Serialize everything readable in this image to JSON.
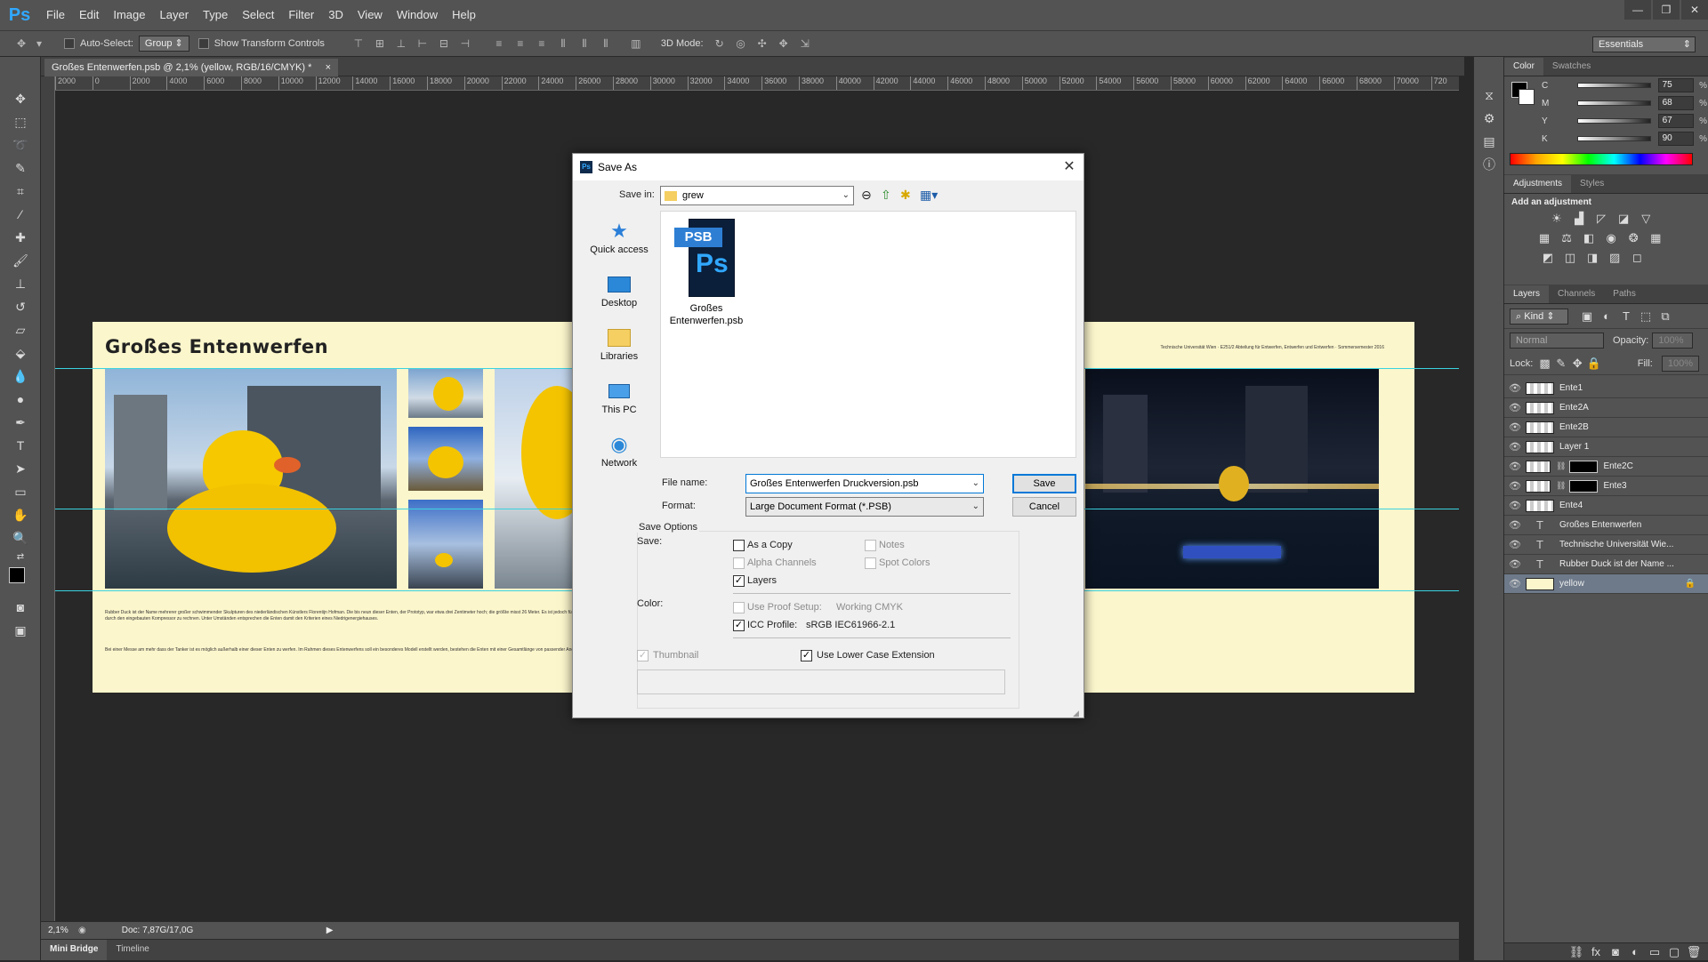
{
  "app": {
    "logo": "Ps",
    "menu": [
      "File",
      "Edit",
      "Image",
      "Layer",
      "Type",
      "Select",
      "Filter",
      "3D",
      "View",
      "Window",
      "Help"
    ]
  },
  "options_bar": {
    "auto_select_label": "Auto-Select:",
    "auto_select_value": "Group",
    "show_transform_label": "Show Transform Controls",
    "mode_3d_label": "3D Mode:",
    "workspace": "Essentials"
  },
  "document": {
    "tab_title": "Großes Entenwerfen.psb @ 2,1% (yellow, RGB/16/CMYK) *",
    "ruler_ticks": [
      "2000",
      "0",
      "2000",
      "4000",
      "6000",
      "8000",
      "10000",
      "12000",
      "14000",
      "16000",
      "18000",
      "20000",
      "22000",
      "24000",
      "26000",
      "28000",
      "30000",
      "32000",
      "34000",
      "36000",
      "38000",
      "40000",
      "42000",
      "44000",
      "46000",
      "48000",
      "50000",
      "52000",
      "54000",
      "56000",
      "58000",
      "60000",
      "62000",
      "64000",
      "66000",
      "68000",
      "70000",
      "720"
    ],
    "artboard_title": "Großes Entenwerfen",
    "artboard_subtitle": "Technische Universität Wien · E251/2 Abteilung für Entwerfen, Entwerfen und Entwerfen · Sommersemester 2016",
    "body_text_1": "Rubber Duck ist der Name mehrerer großer schwimmender Skulpturen des niederländischen Künstlers Florentijn Hofman. Die bis neun dieser Enten, der Prototyp, war etwa drei Zentimeter hoch; die größte misst 26 Meter. Es ist jedoch für die Ente als Wahr- oder Zweckbau zu behandeln, da sie mit dem gesamten Lärm- und Sicherheitsaufwand für entsprucht, insbesondere den brandpolizeilichen Vorgaben, es wurde Verfahren mit Energieverbrauch durch den eingebauten Kompressor zu rechnen. Unter Umständen entsprechen die Enten damit den Kriterien eines Niedrigenergiehauses.",
    "body_text_2": "Bei einer Messe am mehr dass der Tanker ist es möglich außerhalb einer dieser Enten zu werfen. Im Rahmen dieses Entenwerfens soll ein besonderes Modell erstellt werden, bestehen die Enten mit einer Gesamtlänge von passender Anordnung dieses Modells ist bei ein Einsätze des notwendigen weiteren Bestätigungen geschehen. Ich freue mich bei Enten mit 15 bis bald jetzt berichten."
  },
  "status": {
    "zoom": "2,1%",
    "doc_info": "Doc: 7,87G/17,0G"
  },
  "bottom_tabs": [
    "Mini Bridge",
    "Timeline"
  ],
  "color_panel": {
    "tabs": [
      "Color",
      "Swatches"
    ],
    "channels": [
      {
        "label": "C",
        "value": "75"
      },
      {
        "label": "M",
        "value": "68"
      },
      {
        "label": "Y",
        "value": "67"
      },
      {
        "label": "K",
        "value": "90"
      }
    ],
    "percent": "%"
  },
  "adjustments_panel": {
    "tabs": [
      "Adjustments",
      "Styles"
    ],
    "heading": "Add an adjustment"
  },
  "layers_panel": {
    "tabs": [
      "Layers",
      "Channels",
      "Paths"
    ],
    "filter_kind": "Kind",
    "blend_mode": "Normal",
    "opacity_label": "Opacity:",
    "opacity_value": "100%",
    "lock_label": "Lock:",
    "fill_label": "Fill:",
    "fill_value": "100%",
    "layers": [
      {
        "name": "Ente1",
        "kind": "image"
      },
      {
        "name": "Ente2A",
        "kind": "image"
      },
      {
        "name": "Ente2B",
        "kind": "image"
      },
      {
        "name": "Layer 1",
        "kind": "image"
      },
      {
        "name": "Ente2C",
        "kind": "masked"
      },
      {
        "name": "Ente3",
        "kind": "masked"
      },
      {
        "name": "Ente4",
        "kind": "image"
      },
      {
        "name": "Großes Entenwerfen",
        "kind": "text"
      },
      {
        "name": "Technische Universität Wie...",
        "kind": "text"
      },
      {
        "name": "Rubber Duck ist der Name ...",
        "kind": "text"
      },
      {
        "name": "yellow",
        "kind": "fill"
      }
    ]
  },
  "dialog": {
    "title": "Save As",
    "save_in_label": "Save in:",
    "save_in_value": "grew",
    "places": [
      "Quick access",
      "Desktop",
      "Libraries",
      "This PC",
      "Network"
    ],
    "file_badge": "PSB",
    "file_name_display": "Großes Entenwerfen.psb",
    "file_name_label": "File name:",
    "file_name_value": "Großes Entenwerfen Druckversion.psb",
    "format_label": "Format:",
    "format_value": "Large Document Format (*.PSB)",
    "save_button": "Save",
    "cancel_button": "Cancel",
    "save_options_heading": "Save Options",
    "save_label": "Save:",
    "opt_as_copy": "As a Copy",
    "opt_notes": "Notes",
    "opt_alpha": "Alpha Channels",
    "opt_spot": "Spot Colors",
    "opt_layers": "Layers",
    "color_label": "Color:",
    "opt_proof": "Use Proof Setup:",
    "proof_value": "Working CMYK",
    "opt_icc": "ICC Profile:",
    "icc_value": "sRGB IEC61966-2.1",
    "opt_thumbnail": "Thumbnail",
    "opt_lower_case": "Use Lower Case Extension",
    "check_mark": "✓"
  }
}
